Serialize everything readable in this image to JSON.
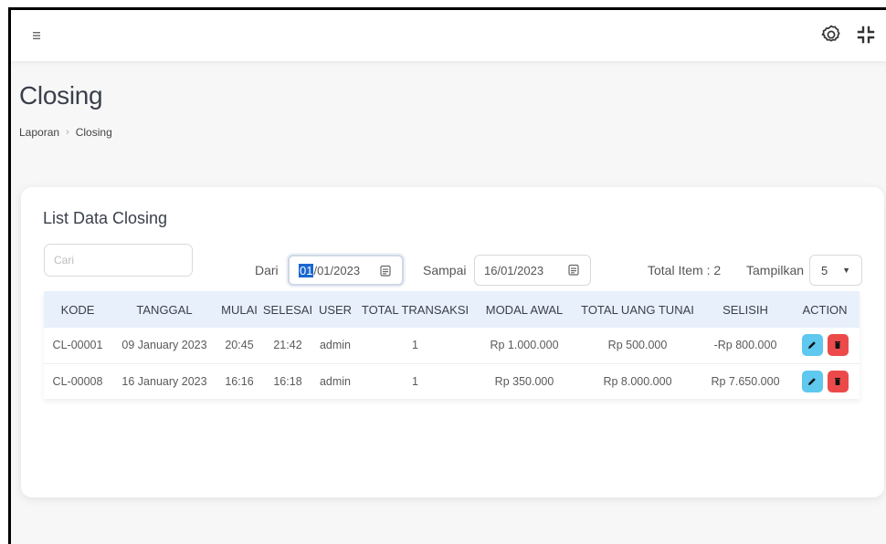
{
  "page": {
    "title": "Closing",
    "breadcrumb": [
      "Laporan",
      "Closing"
    ]
  },
  "topbar": {
    "icons": [
      "menu-icon",
      "gear-icon",
      "compress-icon"
    ]
  },
  "card": {
    "title": "List Data Closing",
    "search_placeholder": "Cari",
    "from_label": "Dari",
    "from_value_selected": "01",
    "from_value_rest": "/01/2023",
    "to_label": "Sampai",
    "to_value": "16/01/2023",
    "total_label": "Total Item : 2",
    "show_label": "Tampilkan",
    "show_value": "5"
  },
  "table": {
    "headers": [
      "KODE",
      "TANGGAL",
      "MULAI",
      "SELESAI",
      "USER",
      "TOTAL TRANSAKSI",
      "MODAL AWAL",
      "TOTAL UANG TUNAI",
      "SELISIH",
      "ACTION"
    ],
    "rows": [
      [
        "CL-00001",
        "09 January 2023",
        "20:45",
        "21:42",
        "admin",
        "1",
        "Rp 1.000.000",
        "Rp 500.000",
        "-Rp 800.000"
      ],
      [
        "CL-00008",
        "16 January 2023",
        "16:16",
        "16:18",
        "admin",
        "1",
        "Rp 350.000",
        "Rp 8.000.000",
        "Rp 7.650.000"
      ]
    ]
  },
  "colors": {
    "header_bg": "#e8f0fb",
    "edit": "#5ec8ee",
    "delete": "#ec4a4a",
    "selection": "#1967d2"
  }
}
